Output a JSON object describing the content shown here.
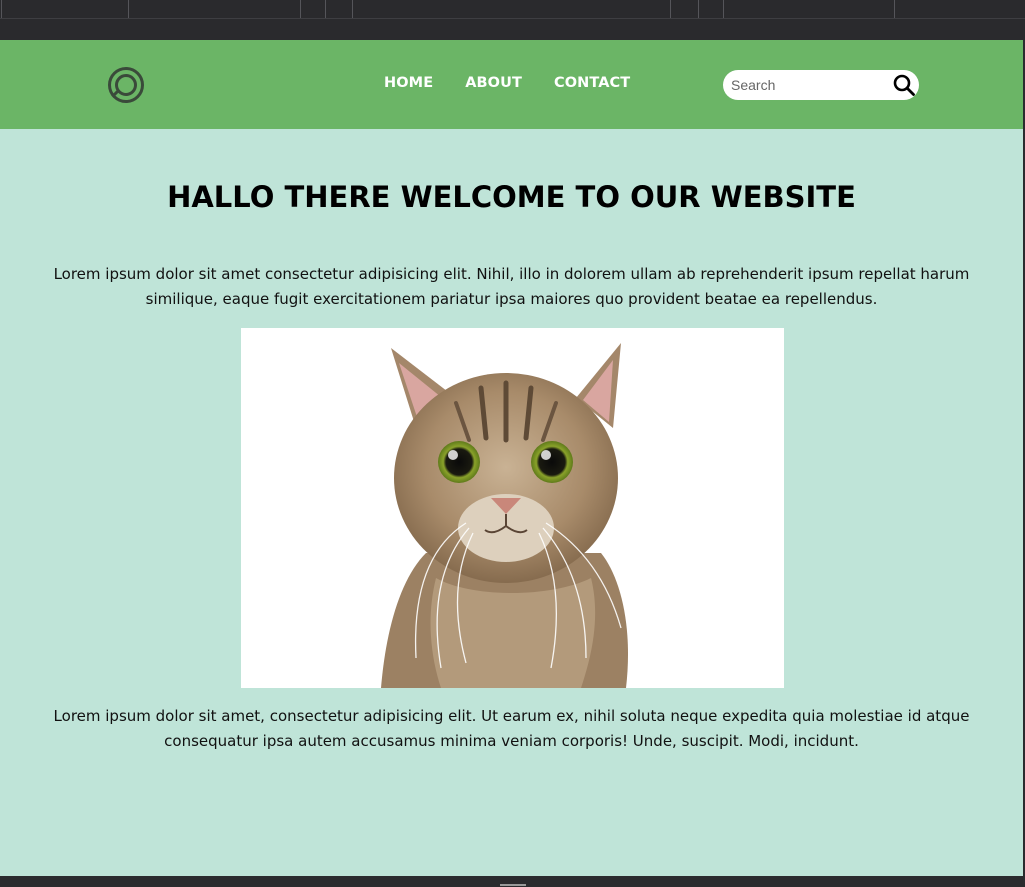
{
  "nav": {
    "links": [
      "HOME",
      "ABOUT",
      "CONTACT"
    ],
    "search_placeholder": "Search",
    "logo_icon": "magnifier-logo-icon",
    "search_icon": "search-icon"
  },
  "main": {
    "heading": "HALLO THERE WELCOME TO OUR WEBSITE",
    "paragraph_1": "Lorem ipsum dolor sit amet consectetur adipisicing elit. Nihil, illo in dolorem ullam ab reprehenderit ipsum repellat harum similique, eaque fugit exercitationem pariatur ipsa maiores quo provident beatae ea repellendus.",
    "image_subject": "cat-photo",
    "paragraph_2": "Lorem ipsum dolor sit amet, consectetur adipisicing elit. Ut earum ex, nihil soluta neque expedita quia molestiae id atque consequatur ipsa autem accusamus minima veniam corporis! Unde, suscipit. Modi, incidunt."
  },
  "colors": {
    "navbar": "#6bb566",
    "page_background": "#bfe4d8",
    "chrome": "#2b2b2e",
    "nav_text": "#ffffff"
  }
}
